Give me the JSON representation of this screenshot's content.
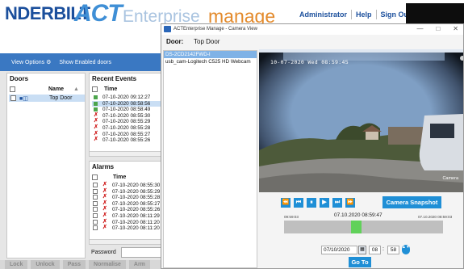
{
  "brand": {
    "logo_left": "NDERBILT",
    "logo_act": "ACT",
    "logo_enterprise": "Enterprise",
    "logo_manage": "manage"
  },
  "top_links": [
    "Administrator",
    "Help",
    "Sign Out"
  ],
  "view_bar": {
    "view_options": "View Options",
    "view_options_icon": "⚙",
    "show_enabled": "Show Enabled doors"
  },
  "doors": {
    "title": "Doors",
    "col_name": "Name",
    "sort_icon": "▲",
    "rows": [
      {
        "name": "Top Door"
      }
    ]
  },
  "recent_events": {
    "title": "Recent Events",
    "col_time": "Time",
    "rows": [
      {
        "time": "07-10-2020 09:12:27",
        "status": "green"
      },
      {
        "time": "07-10-2020 08:58:56",
        "status": "green"
      },
      {
        "time": "07-10-2020 08:58:49",
        "status": "green"
      },
      {
        "time": "07-10-2020 08:55:30",
        "status": "red"
      },
      {
        "time": "07-10-2020 08:55:29",
        "status": "red"
      },
      {
        "time": "07-10-2020 08:55:28",
        "status": "red"
      },
      {
        "time": "07-10-2020 08:55:27",
        "status": "red"
      },
      {
        "time": "07-10-2020 08:55:26",
        "status": "red"
      }
    ]
  },
  "alarms": {
    "title": "Alarms",
    "col_time": "Time",
    "rows": [
      {
        "time": "07-10-2020 08:55:30"
      },
      {
        "time": "07-10-2020 08:55:29"
      },
      {
        "time": "07-10-2020 08:55:28"
      },
      {
        "time": "07-10-2020 08:55:27"
      },
      {
        "time": "07-10-2020 08:55:26"
      },
      {
        "time": "07-10-2020 08:11:29"
      },
      {
        "time": "07-10-2020 08:11:20"
      },
      {
        "time": "07-10-2020 08:11:20"
      }
    ]
  },
  "password_label": "Password",
  "commands": [
    "Lock",
    "Unlock",
    "Pass",
    "Normalise",
    "Arm"
  ],
  "camera_window": {
    "title": "ACTEnterprise Manage - Camera View",
    "win_controls": [
      "—",
      "□",
      "✕"
    ],
    "door_label": "Door:",
    "door_value": "Top Door",
    "cameras": [
      {
        "name": "DS-2CD2142FWD-I",
        "selected": true
      },
      {
        "name": "usb_cam-Logitech C525 HD Webcam",
        "selected": false
      }
    ],
    "video_timestamp": "10-07-2020 Wed 08:59:45",
    "video_camera_label": "Camera",
    "playback_controls": [
      "⏪",
      "⏮",
      "⏸",
      "▶",
      "⏭",
      "⏩"
    ],
    "snapshot_label": "Camera Snapshot",
    "timeline": {
      "start": "09:59:03",
      "center": "07.10.2020 08:59:47",
      "end": "07.10.2020 08:59:03",
      "position": 0.45
    },
    "date_value": "07/10/2020",
    "calendar_icon": "▦",
    "hour_value": "08",
    "minute_value": "58",
    "spin_icon": "▲▼",
    "goto_label": "Go To"
  },
  "colors": {
    "brand_blue": "#1b4f9c",
    "act_blue": "#3f8fd6",
    "manage_orange": "#e38a2b",
    "button_blue": "#1f8fd6",
    "timeline_marker": "#61d15a"
  }
}
